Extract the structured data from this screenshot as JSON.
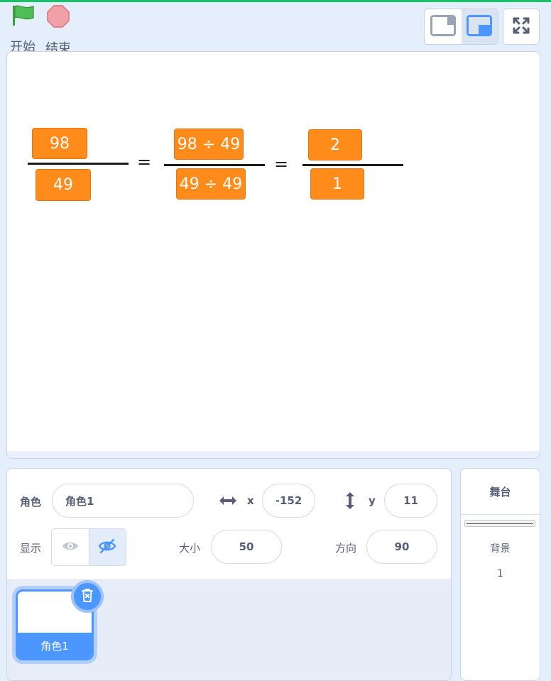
{
  "controls": {
    "start_label": "开始",
    "stop_label": "结束"
  },
  "stage": {
    "fraction1": {
      "numerator": "98",
      "denominator": "49"
    },
    "fraction2": {
      "numerator": "98 ÷ 49",
      "denominator": "49 ÷ 49"
    },
    "fraction3": {
      "numerator": "2",
      "denominator": "1"
    },
    "equals": "="
  },
  "sprite_info": {
    "sprite_label": "角色",
    "sprite_name": "角色1",
    "x_label": "x",
    "x_value": "-152",
    "y_label": "y",
    "y_value": "11",
    "show_label": "显示",
    "size_label": "大小",
    "size_value": "50",
    "direction_label": "方向",
    "direction_value": "90"
  },
  "sprite_list": [
    {
      "name": "角色1"
    }
  ],
  "stage_panel": {
    "title": "舞台",
    "backdrop_label": "背景",
    "backdrop_count": "1"
  },
  "colors": {
    "accent": "#4c97ff",
    "card": "#ff8c1a",
    "flag": "#4cbf56",
    "stop": "#ec5959"
  }
}
